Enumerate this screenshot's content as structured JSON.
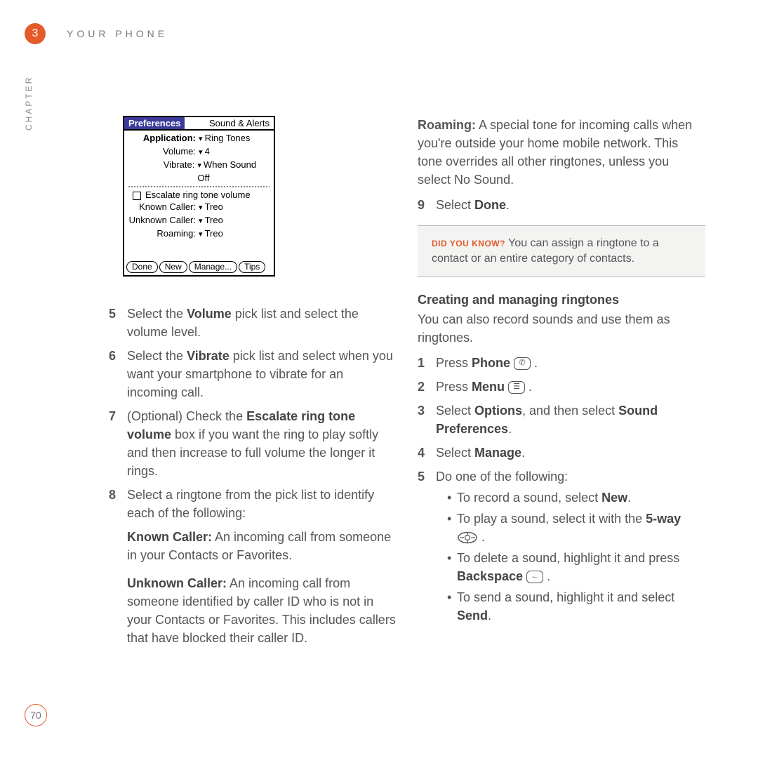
{
  "header": {
    "chapter_num": "3",
    "chapter_label": "CHAPTER",
    "section": "YOUR PHONE"
  },
  "preferences_screen": {
    "title_left": "Preferences",
    "title_right": "Sound & Alerts",
    "rows": {
      "application": {
        "label": "Application:",
        "value": "Ring Tones"
      },
      "volume": {
        "label": "Volume:",
        "value": "4"
      },
      "vibrate": {
        "label": "Vibrate:",
        "value": "When Sound Off"
      },
      "escalate": "Escalate ring tone volume",
      "known": {
        "label": "Known Caller:",
        "value": "Treo"
      },
      "unknown": {
        "label": "Unknown Caller:",
        "value": "Treo"
      },
      "roaming": {
        "label": "Roaming:",
        "value": "Treo"
      }
    },
    "buttons": [
      "Done",
      "New",
      "Manage...",
      "Tips"
    ]
  },
  "left_steps": {
    "s5": {
      "num": "5",
      "pre": "Select the ",
      "b1": "Volume",
      "post": " pick list and select the volume level."
    },
    "s6": {
      "num": "6",
      "pre": "Select the ",
      "b1": "Vibrate",
      "post": " pick list and select when you want your smartphone to vibrate for an incoming call."
    },
    "s7": {
      "num": "7",
      "pre": "(Optional)  Check the ",
      "b1": "Escalate ring tone volume",
      "post": " box if you want the ring to play softly and then increase to full volume the longer it rings."
    },
    "s8": {
      "num": "8",
      "text": "Select a ringtone from the pick list to identify each of the following:",
      "known": {
        "b": "Known Caller:",
        "t": " An incoming call from someone in your Contacts or Favorites."
      },
      "unknown": {
        "b": "Unknown Caller:",
        "t": " An incoming call from someone identified by caller ID who is not in your Contacts or Favorites. This includes callers that have blocked their caller ID."
      }
    }
  },
  "right": {
    "roaming": {
      "b": "Roaming:",
      "t": " A special tone for incoming calls when you're outside your home mobile network. This tone overrides all other ringtones, unless you select No Sound."
    },
    "s9": {
      "num": "9",
      "pre": "Select ",
      "b": "Done",
      "post": "."
    },
    "callout": {
      "lead": "DID YOU KNOW?",
      "text": "  You can assign a ringtone to a contact or an entire category of contacts."
    },
    "subhead": "Creating and managing ringtones",
    "intro": "You can also record sounds and use them as ringtones.",
    "r1": {
      "num": "1",
      "pre": "Press ",
      "b": "Phone",
      "post": " ."
    },
    "r2": {
      "num": "2",
      "pre": "Press ",
      "b": "Menu",
      "post": " ."
    },
    "r3": {
      "num": "3",
      "pre": "Select ",
      "b1": "Options",
      "mid": ", and then select ",
      "b2": "Sound Preferences",
      "post": "."
    },
    "r4": {
      "num": "4",
      "pre": "Select ",
      "b": "Manage",
      "post": "."
    },
    "r5": {
      "num": "5",
      "text": "Do one of the following:",
      "b1": {
        "pre": "To record a sound, select ",
        "b": "New",
        "post": "."
      },
      "b2": {
        "pre": "To play a sound, select it with the ",
        "b": "5-way",
        "post": " ."
      },
      "b3": {
        "pre": "To delete a sound, highlight it and press ",
        "b": "Backspace",
        "post": " ."
      },
      "b4": {
        "pre": "To send a sound, highlight it and select ",
        "b": "Send",
        "post": "."
      }
    }
  },
  "page_number": "70"
}
